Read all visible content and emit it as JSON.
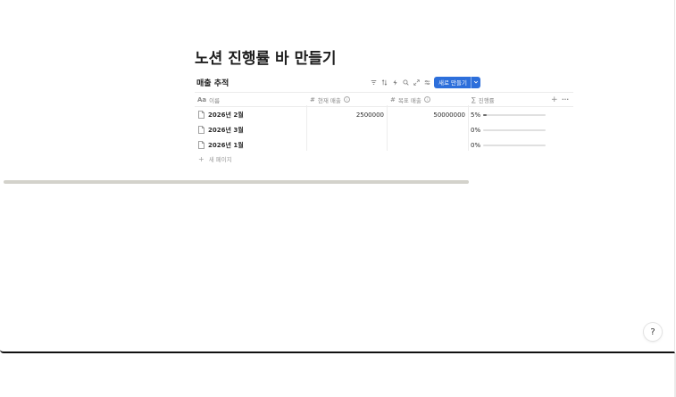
{
  "page": {
    "title": "노션 진행률 바 만들기"
  },
  "database": {
    "title": "매출 추적",
    "toolbar": {
      "icons": [
        "filter-icon",
        "sort-icon",
        "lightning-icon",
        "search-icon",
        "expand-icon",
        "settings-icon"
      ],
      "new_button_label": "새로 만들기"
    },
    "columns": [
      {
        "icon": "Aa",
        "label": "이름"
      },
      {
        "icon": "#",
        "label": "현재 매출"
      },
      {
        "icon": "#",
        "label": "목표 매출"
      },
      {
        "icon": "∑",
        "label": "진행률"
      }
    ],
    "add_column_glyph": "+",
    "more_glyph": "···",
    "rows": [
      {
        "name": "2026년 2월",
        "current": "2500000",
        "target": "50000000",
        "progress_label": "5%",
        "progress": 0.05
      },
      {
        "name": "2026년 3월",
        "current": "",
        "target": "",
        "progress_label": "0%",
        "progress": 0
      },
      {
        "name": "2026년 1월",
        "current": "",
        "target": "",
        "progress_label": "0%",
        "progress": 0
      }
    ],
    "new_page_label": "새 페이지"
  },
  "help_button": {
    "glyph": "?"
  },
  "colors": {
    "accent": "#2d6fdb",
    "progress_fill": "#6b6b6b",
    "progress_track": "#e0e0e0",
    "scrollbar": "#d3d2cb"
  }
}
